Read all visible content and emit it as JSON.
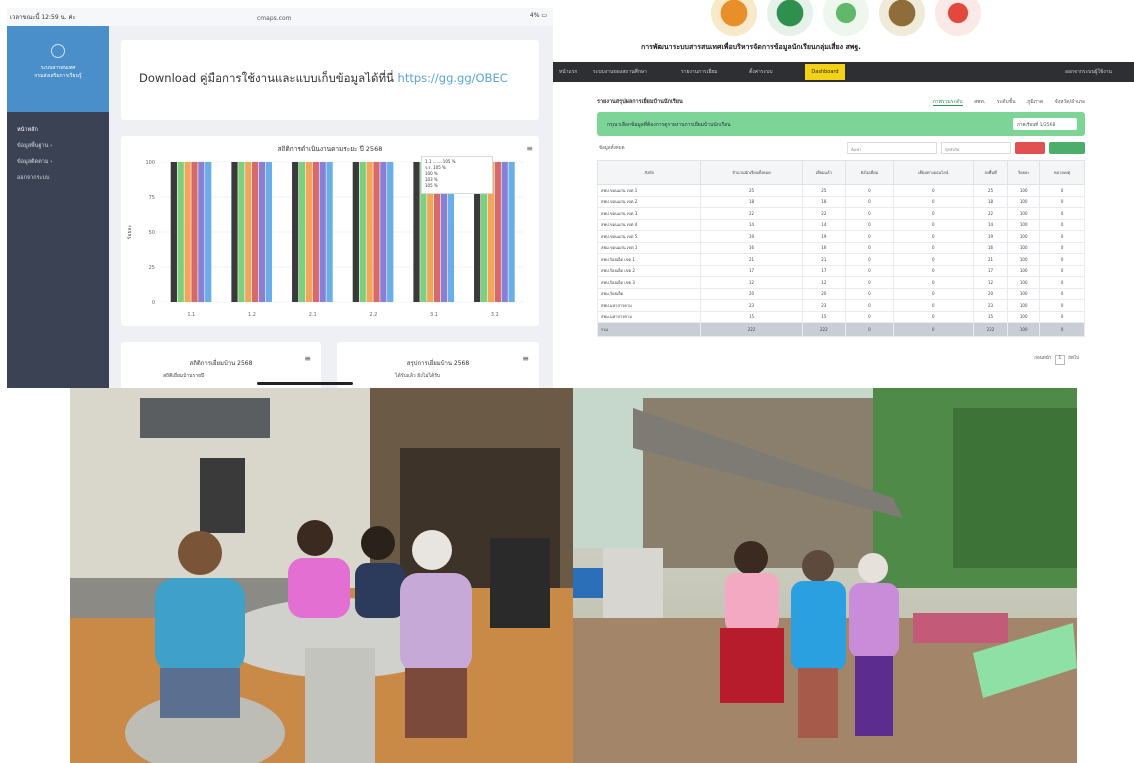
{
  "panel1": {
    "status_left": "เวลาขณะนี้ 12:59 น. ค่ะ",
    "status_center": "cmaps.com",
    "status_right": "4% ▭",
    "sidebar": {
      "brand_lines": [
        "ระบบสารสนเทศ",
        "กรมส่งเสริมการเรียนรู้"
      ],
      "items": [
        {
          "label": "หน้าหลัก",
          "active": true
        },
        {
          "label": "ข้อมูลพื้นฐาน ›",
          "active": false
        },
        {
          "label": "ข้อมูลติดตาม ›",
          "active": false
        },
        {
          "label": "ออกจากระบบ",
          "active": false
        }
      ]
    },
    "header_text": "Download คู่มือการใช้งานและแบบเก็บข้อมูลได้ที่นี่",
    "header_link": "https://gg.gg/OBEC",
    "chart_title": "สถิติการดำเนินงานตามระยะ ปี 2568",
    "chart_menu_icon": "menu-icon",
    "legend_rows": [
      "1.1 ....... 105 %",
      "ร.ร. 105 %",
      "100 %",
      "103 %",
      "105 %"
    ],
    "card2_title": "สถิติการเยี่ยมบ้าน 2568",
    "card2_sub": "สถิติเยี่ยมบ้านรายปี",
    "card3_title": "สรุปการเยี่ยมบ้าน 2568",
    "card3_sub": "ได้รับแล้ว  ยังไม่ได้รับ"
  },
  "chart_data": {
    "type": "bar",
    "title": "สถิติการดำเนินงานตามระยะ ปี 2568",
    "categories": [
      "1.1",
      "1.2",
      "2.1",
      "2.2",
      "3.1",
      "3.2"
    ],
    "series": [
      {
        "color": "#3a3a3a",
        "values": [
          100,
          100,
          100,
          100,
          100,
          100
        ]
      },
      {
        "color": "#7ccf7c",
        "values": [
          100,
          100,
          100,
          100,
          100,
          100
        ]
      },
      {
        "color": "#f2a65a",
        "values": [
          100,
          100,
          100,
          100,
          100,
          100
        ]
      },
      {
        "color": "#d66a6a",
        "values": [
          100,
          100,
          100,
          100,
          100,
          100
        ]
      },
      {
        "color": "#8a7fd6",
        "values": [
          100,
          100,
          100,
          100,
          100,
          100
        ]
      },
      {
        "color": "#6aaee8",
        "values": [
          100,
          100,
          100,
          100,
          100,
          100
        ]
      }
    ],
    "ylim": [
      0,
      100
    ],
    "yticks": [
      0,
      25,
      50,
      75,
      100
    ],
    "ylabel": "ร้อยละ",
    "grid": true
  },
  "panel2": {
    "title": "การพัฒนาระบบสารสนเทศเพื่อบริหารจัดการข้อมูลนักเรียนกลุ่มเสี่ยง สพฐ.",
    "nav_items": [
      "หน้าแรก",
      "ระบบงานของสถานศึกษา",
      "รายงานการเยี่ยม",
      "ตั้งค่าระบบ",
      "Dashboard"
    ],
    "nav_right": "ออกจากระบบผู้ใช้งาน",
    "heading": "รายงานสรุปผลการเยี่ยมบ้านนักเรียน",
    "tabs": [
      "ภาพรวมระดับ",
      "สพท.",
      "ระดับชั้น",
      "ภูมิภาค",
      "จังหวัด/อำเภอ"
    ],
    "banner_text": "กรุณาเลือกข้อมูลที่ต้องการดูรายงานการเยี่ยมบ้านนักเรียน",
    "banner_select": "ภาคเรียนที่ 1/2568",
    "tools_label": "ข้อมูลทั้งหมด",
    "search_placeholder": "ค้นหา",
    "filter_label": "ทุกสังกัด",
    "columns": [
      "สังกัด",
      "จำนวนนักเรียนทั้งหมด",
      "เยี่ยมแล้ว",
      "ยังไม่เยี่ยม",
      "เยี่ยมทางออนไลน์",
      "ลงพื้นที่",
      "ร้อยละ",
      "หมายเหตุ"
    ],
    "rows": [
      [
        "สพป.ขอนแก่น เขต 1",
        "25",
        "25",
        "0",
        "0",
        "25",
        "100",
        "0"
      ],
      [
        "สพป.ขอนแก่น เขต 2",
        "18",
        "18",
        "0",
        "0",
        "18",
        "100",
        "0"
      ],
      [
        "สพป.ขอนแก่น เขต 3",
        "22",
        "22",
        "0",
        "0",
        "22",
        "100",
        "0"
      ],
      [
        "สพป.ขอนแก่น เขต 4",
        "14",
        "14",
        "0",
        "0",
        "14",
        "100",
        "0"
      ],
      [
        "สพป.ขอนแก่น เขต 5",
        "19",
        "19",
        "0",
        "0",
        "19",
        "100",
        "0"
      ],
      [
        "สพม.ขอนแก่น เขต 1",
        "16",
        "16",
        "0",
        "0",
        "16",
        "100",
        "0"
      ],
      [
        "สพป.ร้อยเอ็ด เขต 1",
        "21",
        "21",
        "0",
        "0",
        "21",
        "100",
        "0"
      ],
      [
        "สพป.ร้อยเอ็ด เขต 2",
        "17",
        "17",
        "0",
        "0",
        "17",
        "100",
        "0"
      ],
      [
        "สพป.ร้อยเอ็ด เขต 3",
        "12",
        "12",
        "0",
        "0",
        "12",
        "100",
        "0"
      ],
      [
        "สพม.ร้อยเอ็ด",
        "20",
        "20",
        "0",
        "0",
        "20",
        "100",
        "0"
      ],
      [
        "สพป.มหาสารคาม",
        "23",
        "23",
        "0",
        "0",
        "23",
        "100",
        "0"
      ],
      [
        "สพม.มหาสารคาม",
        "15",
        "15",
        "0",
        "0",
        "15",
        "100",
        "0"
      ]
    ],
    "total_row": [
      "รวม",
      "222",
      "222",
      "0",
      "0",
      "222",
      "100",
      "0"
    ],
    "pager_prev": "ก่อนหน้า",
    "pager_page": "1",
    "pager_next": "ถัดไป"
  },
  "photos": {
    "photo1_label": "home-visit-photo-1",
    "photo2_label": "home-visit-photo-2"
  }
}
